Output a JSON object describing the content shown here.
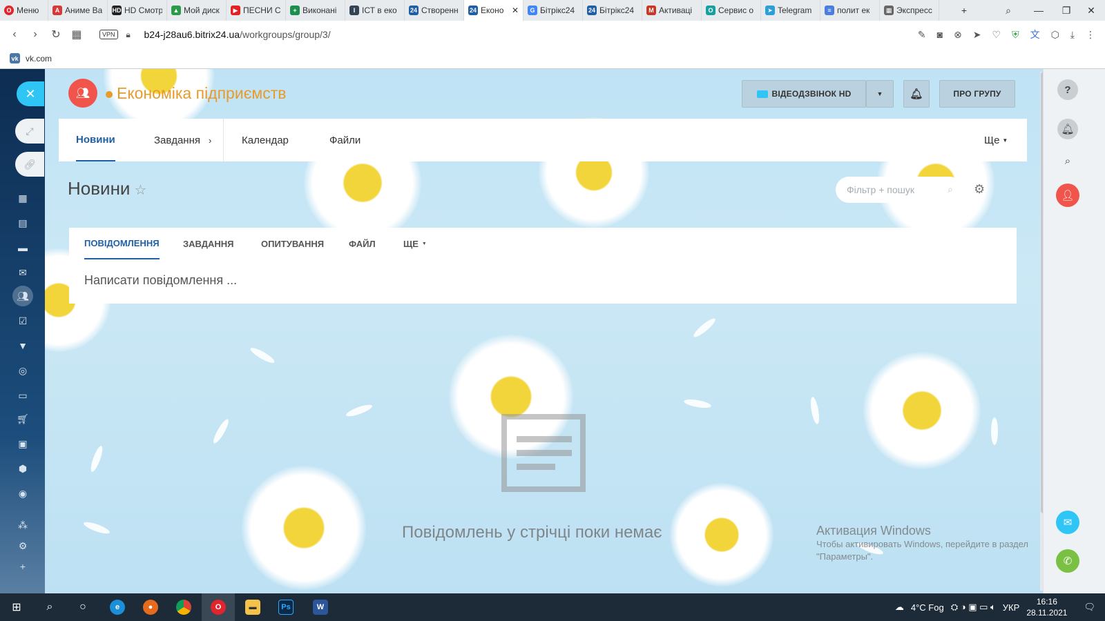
{
  "browser": {
    "menu_label": "Меню",
    "tabs": [
      {
        "label": "Аниме Ва",
        "color": "#d43a3a",
        "glyph": "А"
      },
      {
        "label": "HD Смотреть",
        "color": "#222222",
        "glyph": "HD"
      },
      {
        "label": "Мой диск",
        "color": "#2b9b4b",
        "glyph": "▲"
      },
      {
        "label": "ПЕСНИ С",
        "color": "#e22222",
        "glyph": "▶"
      },
      {
        "label": "Виконані",
        "color": "#1e8e4e",
        "glyph": "+"
      },
      {
        "label": "ІСТ в еко",
        "color": "#334455",
        "glyph": "І"
      },
      {
        "label": "Створенн",
        "color": "#1f5fa6",
        "glyph": "24"
      },
      {
        "label": "Еконо",
        "color": "#1f5fa6",
        "glyph": "24",
        "active": true
      },
      {
        "label": "Бітрікс24",
        "color": "#4285f4",
        "glyph": "G"
      },
      {
        "label": "Бітрікс24",
        "color": "#1f5fa6",
        "glyph": "24"
      },
      {
        "label": "Активаці",
        "color": "#c53929",
        "glyph": "M"
      },
      {
        "label": "Сервис о",
        "color": "#18a0a0",
        "glyph": "O"
      },
      {
        "label": "Telegram",
        "color": "#2a9fd8",
        "glyph": "➤"
      },
      {
        "label": "полит ек",
        "color": "#4a7fe0",
        "glyph": "≡"
      },
      {
        "label": "Экспресс",
        "color": "#666666",
        "glyph": "▦"
      }
    ],
    "url_host": "b24-j28au6.bitrix24.ua",
    "url_path": "/workgroups/group/3/",
    "vpn_label": "VPN",
    "bookmark": "vk.com"
  },
  "group": {
    "title": "Економіка підприємств",
    "video_button": "ВІДЕОДЗВІНОК HD",
    "about_button": "ПРО ГРУПУ"
  },
  "nav": {
    "items": [
      "Новини",
      "Завдання",
      "Календар",
      "Файли"
    ],
    "more": "Ще"
  },
  "feed": {
    "heading": "Новини",
    "filter_placeholder": "Фільтр + пошук",
    "post_tabs": [
      "ПОВІДОМЛЕННЯ",
      "ЗАВДАННЯ",
      "ОПИТУВАННЯ",
      "ФАЙЛ",
      "ЩЕ"
    ],
    "compose_placeholder": "Написати повідомлення ...",
    "empty_text": "Повідомлень у стрічці поки немає"
  },
  "watermark": {
    "title": "Активация Windows",
    "line1": "Чтобы активировать Windows, перейдите в раздел",
    "line2": "\"Параметры\"."
  },
  "taskbar": {
    "weather": "4°C  Fog",
    "lang": "УКР",
    "time": "16:16",
    "date": "28.11.2021"
  },
  "colors": {
    "accent_blue": "#1f5fa6",
    "group_orange": "#e89a2b",
    "group_icon_red": "#f0544a",
    "sidebar_cyan": "#2fc6f6"
  }
}
